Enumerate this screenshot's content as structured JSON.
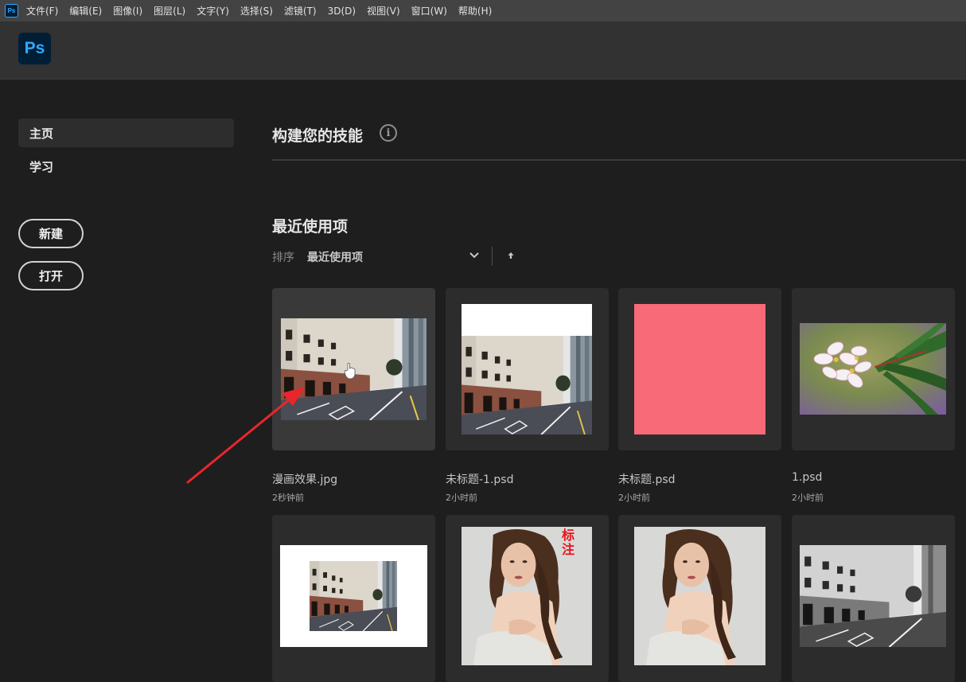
{
  "menubar": {
    "app_icon": "Ps",
    "items": [
      "文件(F)",
      "编辑(E)",
      "图像(I)",
      "图层(L)",
      "文字(Y)",
      "选择(S)",
      "滤镜(T)",
      "3D(D)",
      "视图(V)",
      "窗口(W)",
      "帮助(H)"
    ]
  },
  "header": {
    "logo": "Ps"
  },
  "sidebar": {
    "nav": [
      {
        "label": "主页",
        "active": true
      },
      {
        "label": "学习",
        "active": false
      }
    ],
    "new_button": "新建",
    "open_button": "打开"
  },
  "main": {
    "skills_title": "构建您的技能",
    "info_icon": "i",
    "recent_title": "最近使用项",
    "sort_label": "排序",
    "sort_value": "最近使用项"
  },
  "recent_files": [
    {
      "name": "漫画效果.jpg",
      "time": "2秒钟前",
      "thumb": "street"
    },
    {
      "name": "未标题-1.psd",
      "time": "2小时前",
      "thumb": "street-white-top"
    },
    {
      "name": "未标题.psd",
      "time": "2小时前",
      "thumb": "pink"
    },
    {
      "name": "1.psd",
      "time": "2小时前",
      "thumb": "flower"
    },
    {
      "name": "",
      "time": "",
      "thumb": "street-framed"
    },
    {
      "name": "",
      "time": "",
      "thumb": "woman-annotated",
      "annotation": "标注"
    },
    {
      "name": "",
      "time": "",
      "thumb": "woman"
    },
    {
      "name": "",
      "time": "",
      "thumb": "street-bw"
    }
  ],
  "colors": {
    "accent_blue": "#31a8ff",
    "pink_canvas": "#f86a78",
    "annotation_red": "#e8121b",
    "arrow_red": "#e8262c"
  }
}
